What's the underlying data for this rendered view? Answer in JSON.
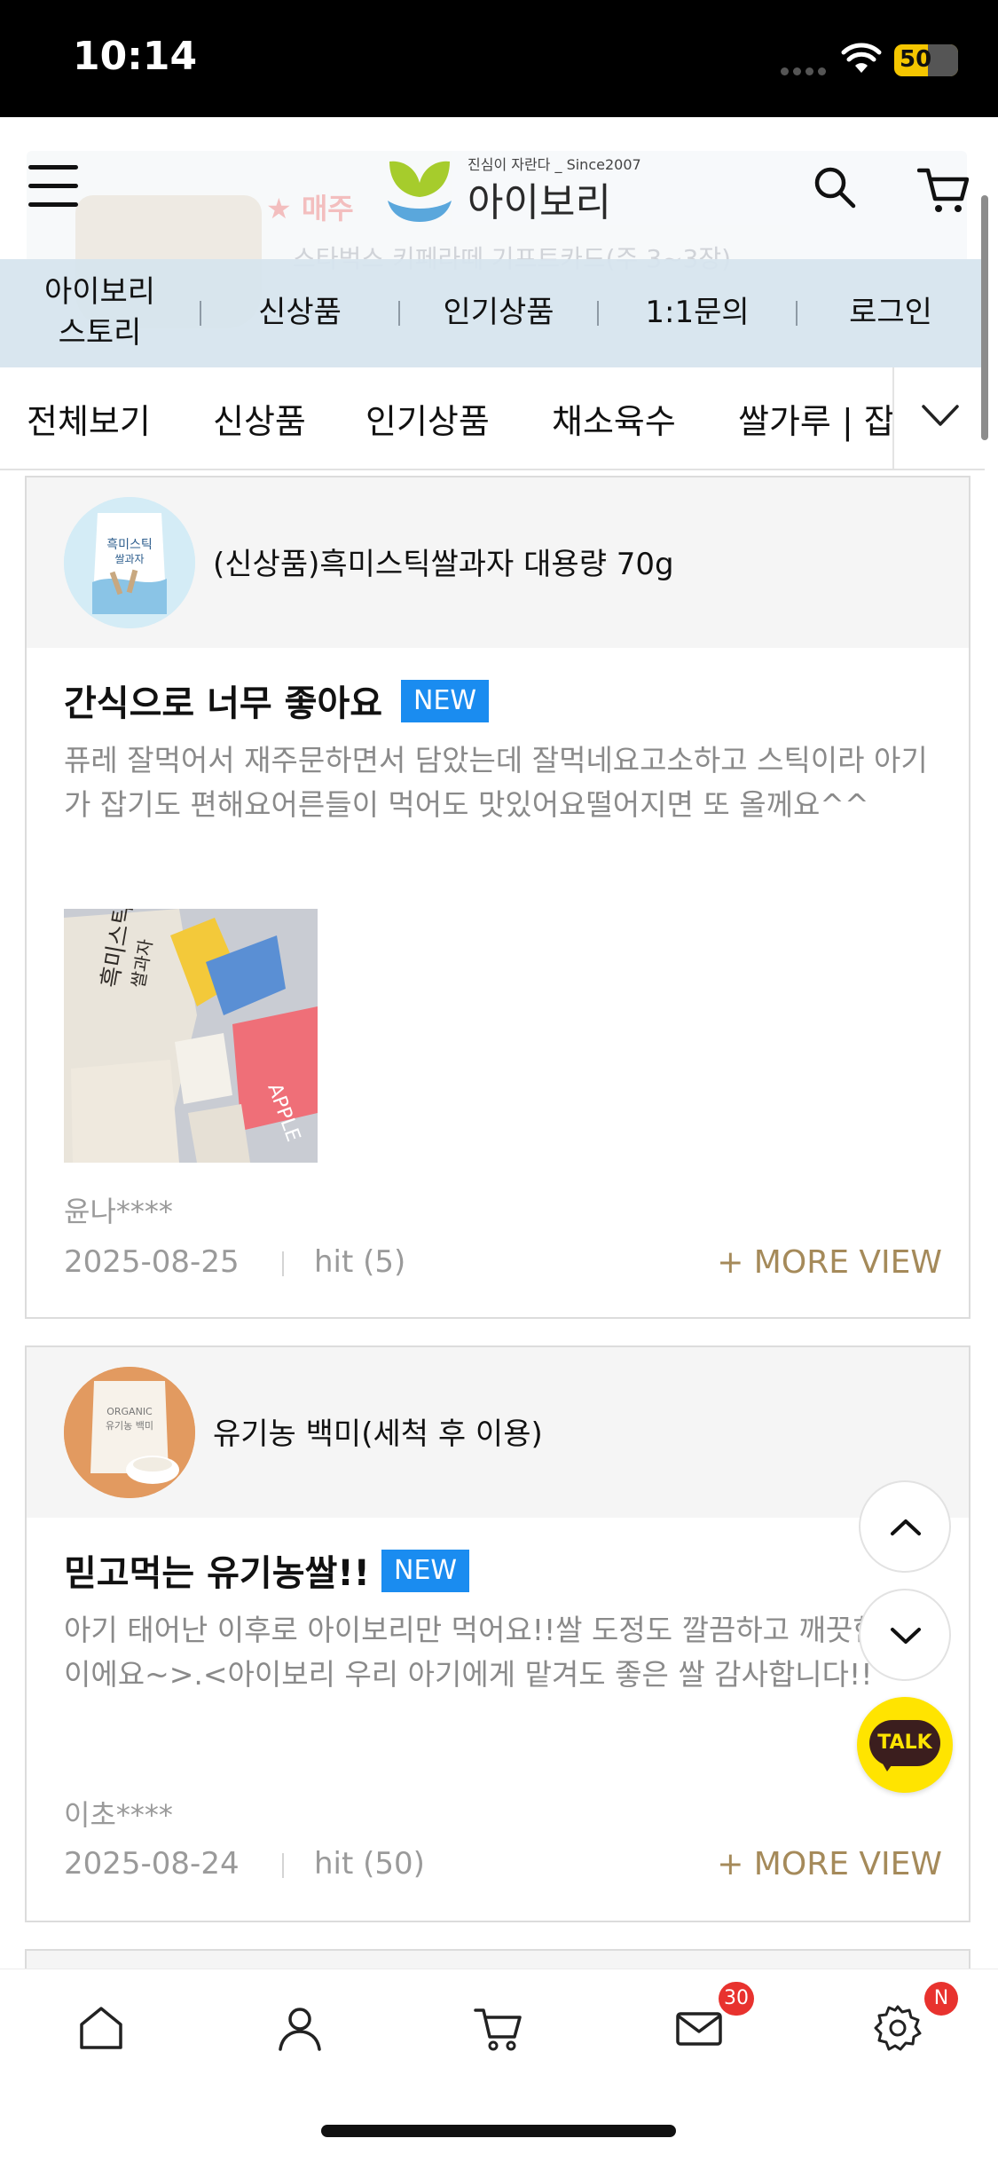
{
  "status_bar": {
    "time": "10:14",
    "battery": "50"
  },
  "header": {
    "logo_tagline": "진심이 자란다 _ Since2007",
    "logo_name": "아이보리"
  },
  "sub_nav": {
    "items": [
      "아이보리\n스토리",
      "신상품",
      "인기상품",
      "1:1문의",
      "로그인"
    ]
  },
  "category_tabs": [
    "전체보기",
    "신상품",
    "인기상품",
    "채소육수",
    "쌀가루 | 잡"
  ],
  "reviews": [
    {
      "product": "(신상품)흑미스틱쌀과자 대용량 70g",
      "title": "간식으로 너무 좋아요",
      "badge": "NEW",
      "body": "퓨레 잘먹어서 재주문하면서 담았는데 잘먹네요고소하고 스틱이라 아기가 잡기도 편해요어른들이 먹어도 맛있어요떨어지면 또 올께요^^",
      "author": "윤나****",
      "date": "2025-08-25",
      "hit": "hit (5)",
      "more": "+ MORE VIEW",
      "thumb_text": "흑미스틱\n쌀과자",
      "photo_text": "흑미스틱\n쌀과자"
    },
    {
      "product": "유기농 백미(세척 후 이용)",
      "title": "믿고먹는 유기농쌀!!",
      "badge": "NEW",
      "body": "아기 태어난 이후로 아이보리만 먹어요!!쌀 도정도 깔끔하고 깨끗한 느낌이에요~>.<아이보리 우리 아기에게 맡겨도 좋은 쌀 감사합니다!!",
      "author": "이초****",
      "date": "2025-08-24",
      "hit": "hit (50)",
      "more": "+ MORE VIEW"
    }
  ],
  "floating": {
    "talk_label": "TALK"
  },
  "tab_bar": {
    "items": [
      "home-icon",
      "person-icon",
      "cart-icon",
      "mail-icon",
      "gear-icon"
    ],
    "mail_badge": "30",
    "settings_badge": "N"
  },
  "colors": {
    "accent_new": "#1a8cf0",
    "more_view": "#a58a5a",
    "subnav_bg": "#d6e4ee",
    "badge_red": "#e8322e",
    "kakao_yellow": "#ffe400"
  }
}
